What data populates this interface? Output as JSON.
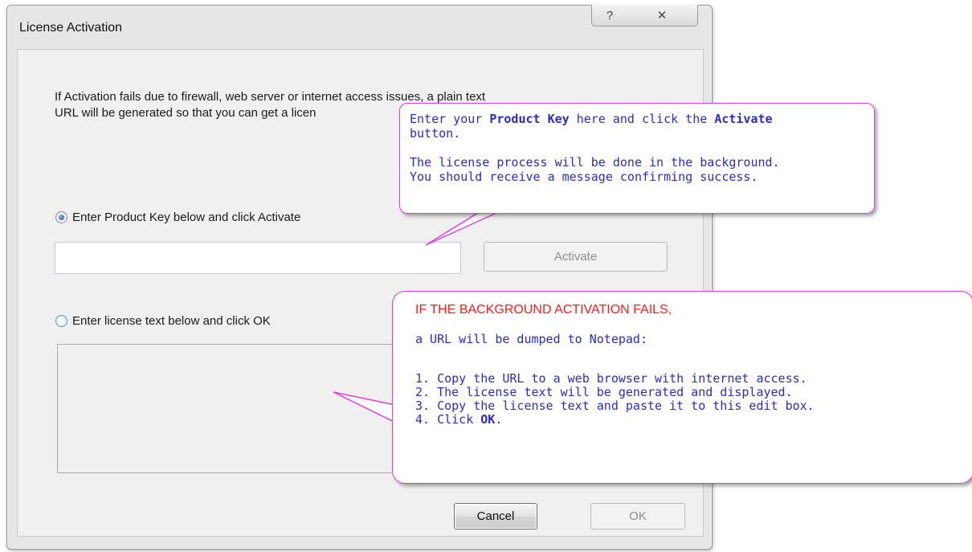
{
  "window": {
    "title": "License Activation",
    "help_glyph": "?",
    "close_glyph": "✕"
  },
  "info": {
    "text": "If Activation fails due to firewall, web server or internet access issues, a plain text\nURL will be generated so that you can get a licen"
  },
  "product_key_option": {
    "label": "Enter Product Key below and click Activate",
    "selected": true,
    "input_value": "",
    "activate_label": "Activate"
  },
  "license_text_option": {
    "label": "Enter license text below and click OK",
    "selected": false,
    "textarea_value": ""
  },
  "footer": {
    "cancel_label": "Cancel",
    "ok_label": "OK"
  },
  "callout_product_key": {
    "line1_a": "Enter your ",
    "line1_b": "Product Key",
    "line1_c": " here and click the ",
    "line1_d": "Activate",
    "line2": "button.",
    "line3": "The license process will be done in the background.",
    "line4": "You should receive a message confirming success."
  },
  "callout_license_text": {
    "warning": "IF THE BACKGROUND ACTIVATION FAILS,",
    "intro": "a URL will be dumped to Notepad:",
    "step1": "1. Copy the URL to a web browser with internet access.",
    "step2": "2. The license text will be generated and displayed.",
    "step3": "3. Copy the license text and paste it to this edit box.",
    "step4_a": "4. Click ",
    "step4_b": "OK",
    "step4_c": "."
  },
  "colors": {
    "callout_border": "#e040e0",
    "callout_text": "#2b2bcc",
    "warning_text": "#ff1a1a"
  }
}
